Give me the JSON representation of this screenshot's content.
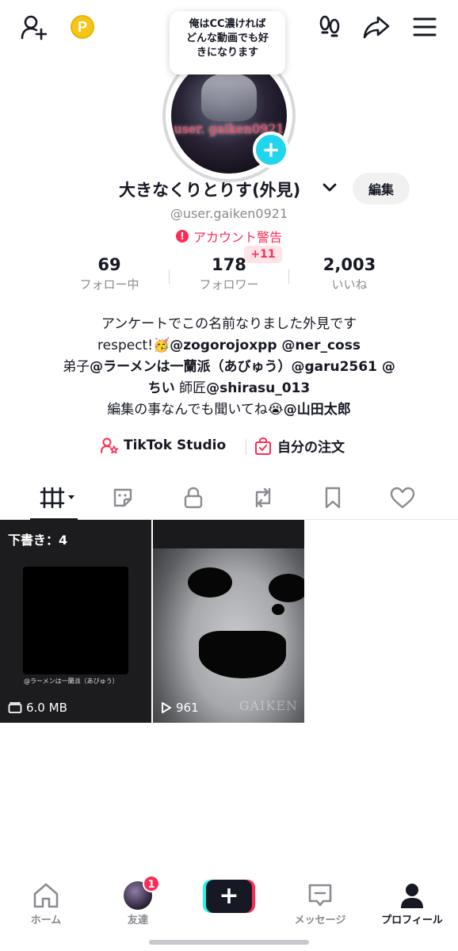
{
  "status_bubble": {
    "line1": "俺はCC濃ければ",
    "line2": "どんな動画でも好",
    "line3": "きになります"
  },
  "avatar": {
    "overlay_text": "user. gaiken0921"
  },
  "profile": {
    "display_name": "大きなくりとりす(外見)",
    "edit_label": "編集",
    "handle": "@user.gaiken0921",
    "warning_label": "アカウント警告"
  },
  "stats": {
    "following": {
      "value": "69",
      "label": "フォロー中"
    },
    "followers": {
      "value": "178",
      "label": "フォロワー",
      "new_badge": "+11"
    },
    "likes": {
      "value": "2,003",
      "label": "いいね"
    }
  },
  "bio": {
    "line1": "アンケートでこの名前なりました外見です",
    "line2_prefix": "respect!🥳",
    "line2_bold": "@zogorojoxpp @ner_coss",
    "line3_prefix": "弟子",
    "line3_bold": "@ラーメンは一蘭派（あびゅう）@garu2561 @",
    "line4_bold1": "ちい",
    "line4_mid": " 師匠",
    "line4_bold2": "@shirasu_013",
    "line5_prefix": "編集の事なんでも聞いてね😭",
    "line5_bold": "@山田太郎"
  },
  "links": {
    "studio": "TikTok Studio",
    "orders": "自分の注文"
  },
  "grid": {
    "draft": {
      "title": "下書き：4",
      "caption": "@ラーメンは一蘭派（あびゅう）",
      "size": "6.0 MB"
    },
    "video": {
      "views": "961",
      "watermark": "GAIKEN"
    }
  },
  "bottom_nav": {
    "home": "ホーム",
    "friends": "友達",
    "friends_badge": "1",
    "messages": "メッセージ",
    "profile": "プロフィール"
  },
  "colors": {
    "accent": "#fe2c55",
    "cyan": "#25f4ee",
    "badge_cyan": "#20d5ec",
    "text": "#161823",
    "muted": "#8a8b91"
  }
}
